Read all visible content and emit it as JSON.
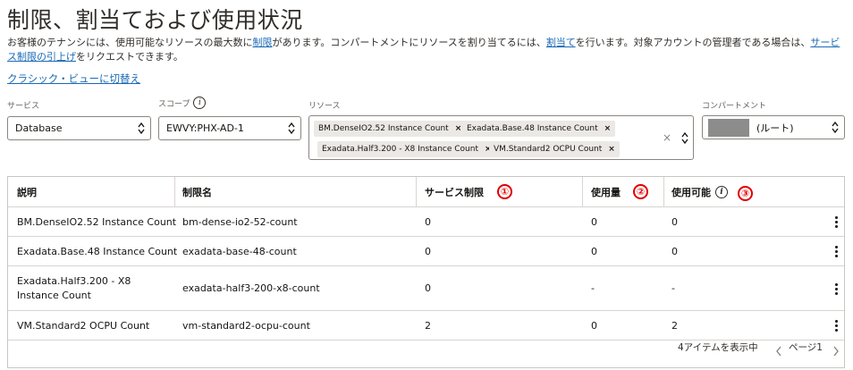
{
  "page": {
    "title": "制限、割当ておよび使用状況",
    "desc_part1": "お客様のテナンシには、使用可能なリソースの最大数に",
    "desc_link1": "制限",
    "desc_part2": "があります。コンパートメントにリソースを割り当てるには、",
    "desc_link2": "割当て",
    "desc_part3": "を行います。対象アカウントの管理者である場合は、",
    "desc_link3": "サービス制限の引上げ",
    "desc_part4": "をリクエストできます。",
    "classic_link": "クラシック・ビューに切替え"
  },
  "filters": {
    "service_label": "サービス",
    "service_value": "Database",
    "scope_label": "スコープ",
    "scope_value": "EWVY:PHX-AD-1",
    "resource_label": "リソース",
    "resource_chips": [
      "BM.DenseIO2.52 Instance Count",
      "Exadata.Base.48 Instance Count",
      "Exadata.Half3.200 - X8 Instance Count",
      "VM.Standard2 OCPU Count"
    ],
    "compartment_label": "コンパートメント",
    "compartment_value": "(ルート)"
  },
  "table": {
    "headers": {
      "description": "説明",
      "limit_name": "制限名",
      "service_limit": "サービス制限",
      "used": "使用量",
      "available": "使用可能"
    },
    "annotations": [
      "①",
      "②",
      "③"
    ],
    "rows": [
      {
        "description": "BM.DenseIO2.52 Instance Count",
        "limit_name": "bm-dense-io2-52-count",
        "service_limit": "0",
        "used": "0",
        "available": "0"
      },
      {
        "description": "Exadata.Base.48 Instance Count",
        "limit_name": "exadata-base-48-count",
        "service_limit": "0",
        "used": "0",
        "available": "0"
      },
      {
        "description": "Exadata.Half3.200 - X8 Instance Count",
        "limit_name": "exadata-half3-200-x8-count",
        "service_limit": "0",
        "used": "-",
        "available": "-"
      },
      {
        "description": "VM.Standard2 OCPU Count",
        "limit_name": "vm-standard2-ocpu-count",
        "service_limit": "2",
        "used": "0",
        "available": "2"
      }
    ]
  },
  "footer": {
    "item_count": "4アイテムを表示中",
    "page_label": "ページ1"
  },
  "colors": {
    "link": "#1a6ab5",
    "annotation": "#e00000",
    "chip_bg": "#ebe8e5"
  }
}
